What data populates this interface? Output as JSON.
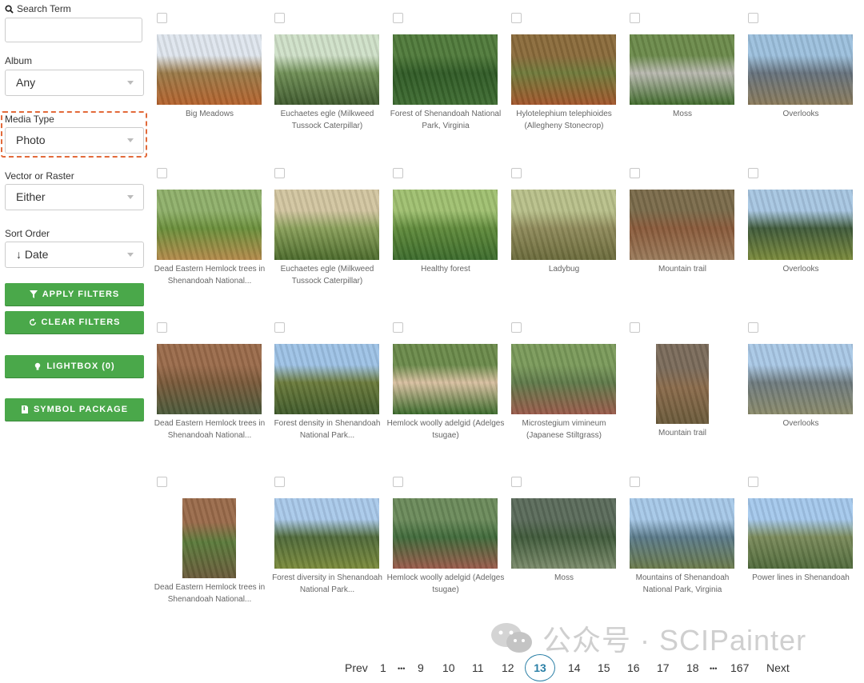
{
  "sidebar": {
    "search_label": "Search Term",
    "search_value": "",
    "album_label": "Album",
    "album_value": "Any",
    "media_type_label": "Media Type",
    "media_type_value": "Photo",
    "vector_label": "Vector or Raster",
    "vector_value": "Either",
    "sort_label": "Sort Order",
    "sort_value": "↓ Date",
    "apply_label": "APPLY FILTERS",
    "clear_label": "CLEAR FILTERS",
    "lightbox_label": "LIGHTBOX (0)",
    "symbol_label": "SYMBOL PACKAGE"
  },
  "colors": {
    "button_green": "#4aa84a",
    "highlight_orange": "#e26a3a",
    "page_active": "#2a7fa6"
  },
  "grid": {
    "rows": [
      [
        {
          "caption": "Big Meadows"
        },
        {
          "caption": "Euchaetes egle (Milkweed Tussock Caterpillar)"
        },
        {
          "caption": "Forest of Shenandoah National Park, Virginia"
        },
        {
          "caption": "Hylotelephium telephioides (Allegheny Stonecrop)"
        },
        {
          "caption": "Moss"
        },
        {
          "caption": "Overlooks"
        }
      ],
      [
        {
          "caption": "Dead Eastern Hemlock trees in Shenandoah National..."
        },
        {
          "caption": "Euchaetes egle (Milkweed Tussock Caterpillar)"
        },
        {
          "caption": "Healthy forest"
        },
        {
          "caption": "Ladybug"
        },
        {
          "caption": "Mountain trail"
        },
        {
          "caption": "Overlooks"
        }
      ],
      [
        {
          "caption": "Dead Eastern Hemlock trees in Shenandoah National..."
        },
        {
          "caption": "Forest density in Shenandoah National Park..."
        },
        {
          "caption": "Hemlock woolly adelgid (Adelges tsugae)"
        },
        {
          "caption": "Microstegium vimineum (Japanese Stiltgrass)"
        },
        {
          "caption": "Mountain trail"
        },
        {
          "caption": "Overlooks"
        }
      ],
      [
        {
          "caption": "Dead Eastern Hemlock trees in Shenandoah National..."
        },
        {
          "caption": "Forest diversity in Shenandoah National Park..."
        },
        {
          "caption": "Hemlock woolly adelgid (Adelges tsugae)"
        },
        {
          "caption": "Moss"
        },
        {
          "caption": "Mountains of Shenandoah National Park, Virginia"
        },
        {
          "caption": "Power lines in Shenandoah"
        }
      ]
    ]
  },
  "pagination": {
    "prev": "Prev",
    "next": "Next",
    "pages": [
      "1",
      "9",
      "10",
      "11",
      "12",
      "13",
      "14",
      "15",
      "16",
      "17",
      "18",
      "167"
    ],
    "ellipsis": "•••",
    "current": "13"
  },
  "watermark": {
    "text": "公众号 · SCIPainter"
  }
}
